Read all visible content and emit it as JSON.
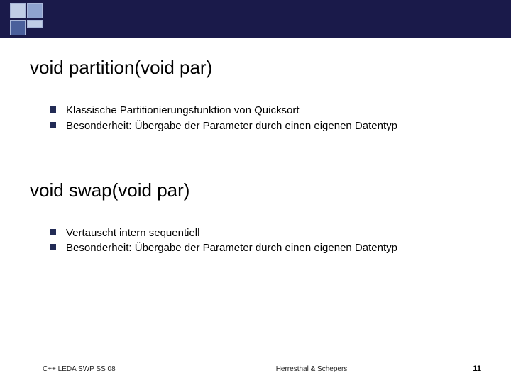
{
  "sections": [
    {
      "heading": "void partition(void par)",
      "bullets": [
        "Klassische Partitionierungsfunktion von Quicksort",
        "Besonderheit: Übergabe der Parameter durch einen eigenen Datentyp"
      ]
    },
    {
      "heading": "void swap(void par)",
      "bullets": [
        "Vertauscht intern sequentiell",
        "Besonderheit: Übergabe der Parameter durch einen eigenen Datentyp"
      ]
    }
  ],
  "footer": {
    "left": "C++ LEDA SWP SS 08",
    "center": "Herresthal & Schepers",
    "right": "11"
  }
}
